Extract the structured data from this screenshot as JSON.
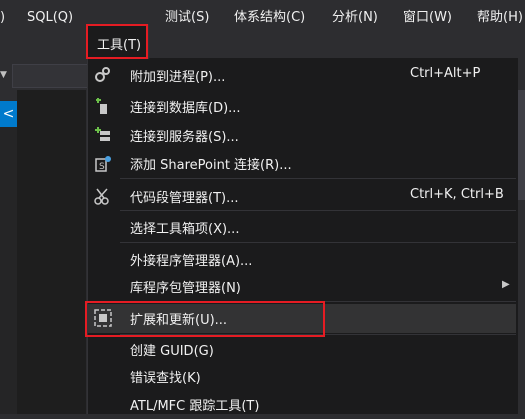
{
  "menubar": {
    "items": [
      {
        "id": "partial",
        "label": ")"
      },
      {
        "id": "sql",
        "label": "SQL(Q)"
      },
      {
        "id": "tools",
        "label": "工具(T)"
      },
      {
        "id": "test",
        "label": "测试(S)"
      },
      {
        "id": "arch",
        "label": "体系结构(C)"
      },
      {
        "id": "analyze",
        "label": "分析(N)"
      },
      {
        "id": "window",
        "label": "窗口(W)"
      },
      {
        "id": "help",
        "label": "帮助(H)"
      }
    ]
  },
  "left_tab": {
    "glyph": "<"
  },
  "tools_menu": {
    "items": [
      {
        "label": "附加到进程(P)...",
        "shortcut": "Ctrl+Alt+P",
        "icon": "gears-icon"
      },
      {
        "label": "连接到数据库(D)...",
        "shortcut": "",
        "icon": "database-plug-icon"
      },
      {
        "label": "连接到服务器(S)...",
        "shortcut": "",
        "icon": "server-add-icon"
      },
      {
        "label": "添加 SharePoint 连接(R)...",
        "shortcut": "",
        "icon": "sharepoint-icon"
      },
      {
        "label": "代码段管理器(T)...",
        "shortcut": "Ctrl+K, Ctrl+B",
        "icon": "scissors-icon"
      },
      {
        "label": "选择工具箱项(X)...",
        "shortcut": "",
        "icon": ""
      },
      {
        "label": "外接程序管理器(A)...",
        "shortcut": "",
        "icon": ""
      },
      {
        "label": "库程序包管理器(N)",
        "shortcut": "",
        "icon": "",
        "submenu": true
      },
      {
        "label": "扩展和更新(U)...",
        "shortcut": "",
        "icon": "extensions-icon"
      },
      {
        "label": "创建 GUID(G)",
        "shortcut": "",
        "icon": ""
      },
      {
        "label": "错误查找(K)",
        "shortcut": "",
        "icon": ""
      },
      {
        "label": "ATL/MFC 跟踪工具(T)",
        "shortcut": "",
        "icon": ""
      }
    ]
  },
  "colors": {
    "highlight": "#e51c23",
    "menu_bg": "#1b1b1c",
    "chrome_bg": "#2d2d30",
    "accent": "#007acc"
  }
}
